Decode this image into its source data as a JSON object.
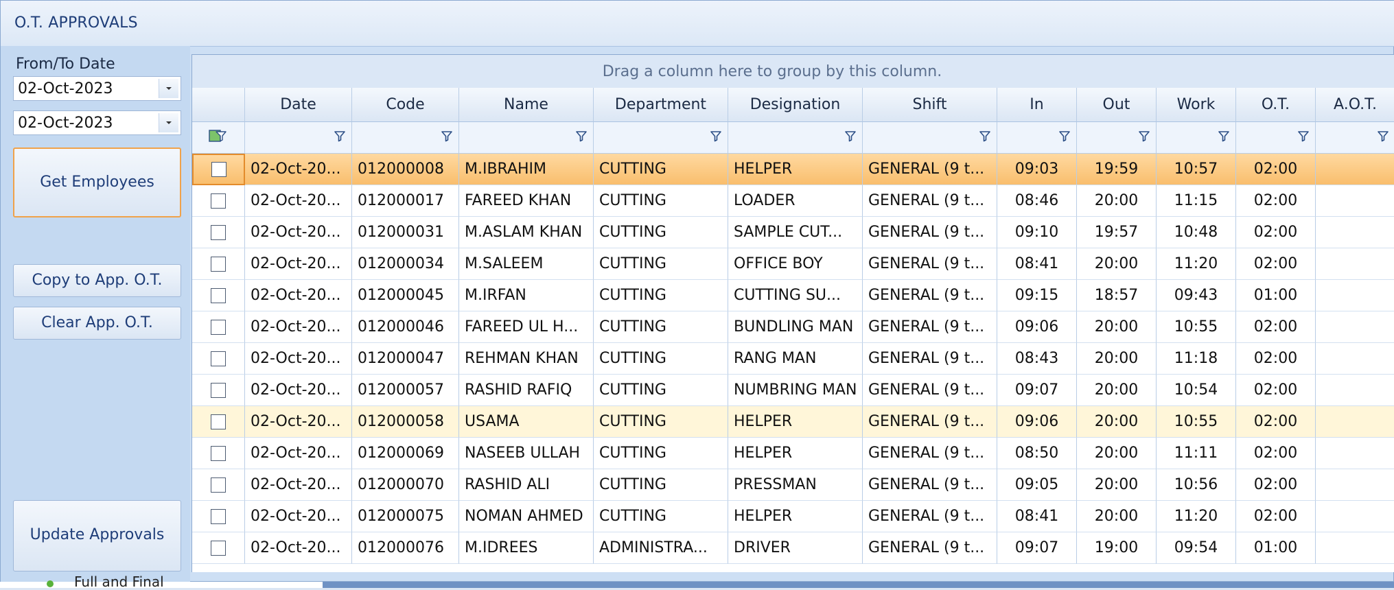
{
  "window": {
    "title": "O.T. APPROVALS"
  },
  "left": {
    "date_label": "From/To Date",
    "from_date": "02-Oct-2023",
    "to_date": "02-Oct-2023",
    "get_employees": "Get Employees",
    "copy_app_ot": "Copy to App. O.T.",
    "clear_app_ot": "Clear App. O.T.",
    "update_approvals": "Update Approvals"
  },
  "grid": {
    "group_hint": "Drag a column here to group by this column.",
    "columns": [
      "Date",
      "Code",
      "Name",
      "Department",
      "Designation",
      "Shift",
      "In",
      "Out",
      "Work",
      "O.T.",
      "A.O.T."
    ],
    "rows": [
      {
        "date": "02-Oct-20...",
        "code": "012000008",
        "name": "M.IBRAHIM",
        "dept": "CUTTING",
        "desig": "HELPER",
        "shift": "GENERAL (9 t...",
        "in": "09:03",
        "out": "19:59",
        "work": "10:57",
        "ot": "02:00",
        "aot": ""
      },
      {
        "date": "02-Oct-20...",
        "code": "012000017",
        "name": "FAREED KHAN",
        "dept": "CUTTING",
        "desig": "LOADER",
        "shift": "GENERAL (9 t...",
        "in": "08:46",
        "out": "20:00",
        "work": "11:15",
        "ot": "02:00",
        "aot": ""
      },
      {
        "date": "02-Oct-20...",
        "code": "012000031",
        "name": "M.ASLAM KHAN",
        "dept": "CUTTING",
        "desig": "SAMPLE CUT...",
        "shift": "GENERAL (9 t...",
        "in": "09:10",
        "out": "19:57",
        "work": "10:48",
        "ot": "02:00",
        "aot": ""
      },
      {
        "date": "02-Oct-20...",
        "code": "012000034",
        "name": "M.SALEEM",
        "dept": "CUTTING",
        "desig": "OFFICE BOY",
        "shift": "GENERAL (9 t...",
        "in": "08:41",
        "out": "20:00",
        "work": "11:20",
        "ot": "02:00",
        "aot": ""
      },
      {
        "date": "02-Oct-20...",
        "code": "012000045",
        "name": "M.IRFAN",
        "dept": "CUTTING",
        "desig": "CUTTING SU...",
        "shift": "GENERAL (9 t...",
        "in": "09:15",
        "out": "18:57",
        "work": "09:43",
        "ot": "01:00",
        "aot": ""
      },
      {
        "date": "02-Oct-20...",
        "code": "012000046",
        "name": "FAREED UL H...",
        "dept": "CUTTING",
        "desig": "BUNDLING MAN",
        "shift": "GENERAL (9 t...",
        "in": "09:06",
        "out": "20:00",
        "work": "10:55",
        "ot": "02:00",
        "aot": ""
      },
      {
        "date": "02-Oct-20...",
        "code": "012000047",
        "name": "REHMAN KHAN",
        "dept": "CUTTING",
        "desig": "RANG MAN",
        "shift": "GENERAL (9 t...",
        "in": "08:43",
        "out": "20:00",
        "work": "11:18",
        "ot": "02:00",
        "aot": ""
      },
      {
        "date": "02-Oct-20...",
        "code": "012000057",
        "name": "RASHID RAFIQ",
        "dept": "CUTTING",
        "desig": "NUMBRING MAN",
        "shift": "GENERAL (9 t...",
        "in": "09:07",
        "out": "20:00",
        "work": "10:54",
        "ot": "02:00",
        "aot": ""
      },
      {
        "date": "02-Oct-20...",
        "code": "012000058",
        "name": "USAMA",
        "dept": "CUTTING",
        "desig": "HELPER",
        "shift": "GENERAL (9 t...",
        "in": "09:06",
        "out": "20:00",
        "work": "10:55",
        "ot": "02:00",
        "aot": ""
      },
      {
        "date": "02-Oct-20...",
        "code": "012000069",
        "name": "NASEEB ULLAH",
        "dept": "CUTTING",
        "desig": "HELPER",
        "shift": "GENERAL (9 t...",
        "in": "08:50",
        "out": "20:00",
        "work": "11:11",
        "ot": "02:00",
        "aot": ""
      },
      {
        "date": "02-Oct-20...",
        "code": "012000070",
        "name": "RASHID ALI",
        "dept": "CUTTING",
        "desig": "PRESSMAN",
        "shift": "GENERAL (9 t...",
        "in": "09:05",
        "out": "20:00",
        "work": "10:56",
        "ot": "02:00",
        "aot": ""
      },
      {
        "date": "02-Oct-20...",
        "code": "012000075",
        "name": "NOMAN AHMED",
        "dept": "CUTTING",
        "desig": "HELPER",
        "shift": "GENERAL (9 t...",
        "in": "08:41",
        "out": "20:00",
        "work": "11:20",
        "ot": "02:00",
        "aot": ""
      },
      {
        "date": "02-Oct-20...",
        "code": "012000076",
        "name": "M.IDREES",
        "dept": "ADMINISTRA...",
        "desig": "DRIVER",
        "shift": "GENERAL (9 t...",
        "in": "09:07",
        "out": "19:00",
        "work": "09:54",
        "ot": "01:00",
        "aot": ""
      }
    ]
  },
  "bottom": {
    "tree_item": "Full and Final"
  },
  "colors": {
    "accent": "#1e3d78",
    "focus": "#f9be6d",
    "hover": "#fff6d9"
  }
}
